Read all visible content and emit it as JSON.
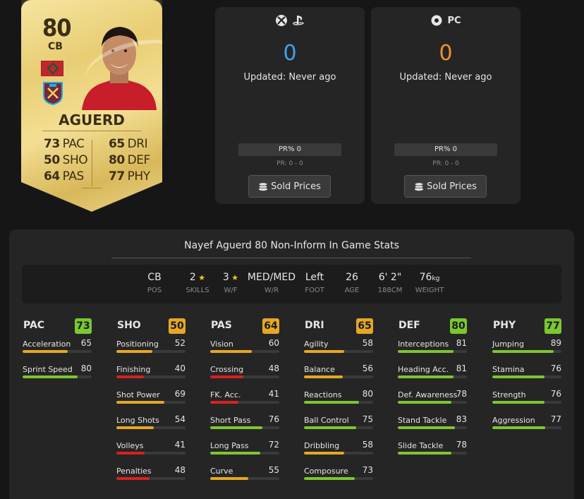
{
  "card": {
    "rating": "80",
    "position": "CB",
    "name": "AGUERD",
    "stats_left": [
      {
        "value": "73",
        "label": "PAC"
      },
      {
        "value": "50",
        "label": "SHO"
      },
      {
        "value": "64",
        "label": "PAS"
      }
    ],
    "stats_right": [
      {
        "value": "65",
        "label": "DRI"
      },
      {
        "value": "80",
        "label": "DEF"
      },
      {
        "value": "77",
        "label": "PHY"
      }
    ]
  },
  "prices": {
    "console": {
      "icons": [
        "xbox-icon",
        "playstation-icon"
      ],
      "value": "0",
      "updated": "Updated: Never ago",
      "pr": "PR% 0",
      "range": "PR: 0 - 0",
      "button": "Sold Prices"
    },
    "pc": {
      "icons": [
        "pc-icon"
      ],
      "platform_label": "PC",
      "value": "0",
      "updated": "Updated: Never ago",
      "pr": "PR% 0",
      "range": "PR: 0 - 0",
      "button": "Sold Prices"
    }
  },
  "stats_panel": {
    "title": "Nayef Aguerd 80 Non-Inform In Game Stats",
    "info": [
      {
        "value": "CB",
        "label": "POS"
      },
      {
        "value": "2",
        "star": true,
        "label": "SKILLS"
      },
      {
        "value": "3",
        "star": true,
        "label": "W/F"
      },
      {
        "value": "MED/MED",
        "label": "W/R"
      },
      {
        "value": "Left",
        "label": "FOOT"
      },
      {
        "value": "26",
        "label": "AGE"
      },
      {
        "value": "6' 2\"",
        "label": "188CM"
      },
      {
        "value": "76",
        "unit": "kg",
        "label": "WEIGHT"
      }
    ],
    "categories": [
      {
        "name": "PAC",
        "value": 73,
        "attributes": [
          {
            "name": "Acceleration",
            "value": 65
          },
          {
            "name": "Sprint Speed",
            "value": 80
          }
        ]
      },
      {
        "name": "SHO",
        "value": 50,
        "attributes": [
          {
            "name": "Positioning",
            "value": 52
          },
          {
            "name": "Finishing",
            "value": 40
          },
          {
            "name": "Shot Power",
            "value": 69
          },
          {
            "name": "Long Shots",
            "value": 54
          },
          {
            "name": "Volleys",
            "value": 41
          },
          {
            "name": "Penalties",
            "value": 48
          }
        ]
      },
      {
        "name": "PAS",
        "value": 64,
        "attributes": [
          {
            "name": "Vision",
            "value": 60
          },
          {
            "name": "Crossing",
            "value": 48
          },
          {
            "name": "FK. Acc.",
            "value": 41
          },
          {
            "name": "Short Pass",
            "value": 76
          },
          {
            "name": "Long Pass",
            "value": 72
          },
          {
            "name": "Curve",
            "value": 55
          }
        ]
      },
      {
        "name": "DRI",
        "value": 65,
        "attributes": [
          {
            "name": "Agility",
            "value": 58
          },
          {
            "name": "Balance",
            "value": 56
          },
          {
            "name": "Reactions",
            "value": 80
          },
          {
            "name": "Ball Control",
            "value": 75
          },
          {
            "name": "Dribbling",
            "value": 58
          },
          {
            "name": "Composure",
            "value": 73
          }
        ]
      },
      {
        "name": "DEF",
        "value": 80,
        "attributes": [
          {
            "name": "Interceptions",
            "value": 81
          },
          {
            "name": "Heading Acc.",
            "value": 81
          },
          {
            "name": "Def. Awareness",
            "value": 78
          },
          {
            "name": "Stand Tackle",
            "value": 83
          },
          {
            "name": "Slide Tackle",
            "value": 78
          }
        ]
      },
      {
        "name": "PHY",
        "value": 77,
        "attributes": [
          {
            "name": "Jumping",
            "value": 89
          },
          {
            "name": "Stamina",
            "value": 76
          },
          {
            "name": "Strength",
            "value": 76
          },
          {
            "name": "Aggression",
            "value": 77
          }
        ]
      }
    ]
  },
  "colors": {
    "high": "#7ac72f",
    "mid": "#e5a823",
    "low": "#d7221f",
    "console_price": "#3ea2ea",
    "pc_price": "#f0912b"
  }
}
